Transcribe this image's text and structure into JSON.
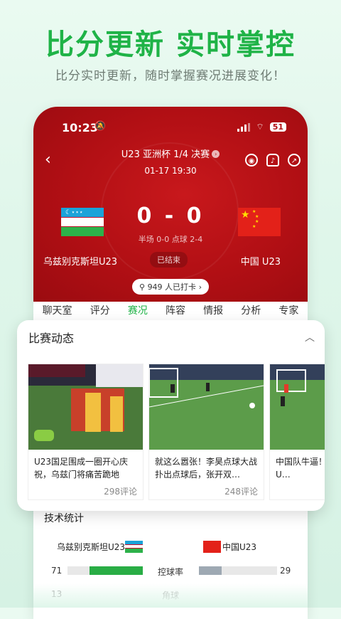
{
  "promo": {
    "headline": "比分更新 实时掌控",
    "subline": "比分实时更新，随时掌握赛况进展变化！"
  },
  "status_bar": {
    "time": "10:23",
    "battery": "51"
  },
  "match": {
    "title": "U23 亚洲杯 1/4 决赛",
    "datetime": "01-17 19:30",
    "score": "0 - 0",
    "detail": "半场 0-0 点球 2-4",
    "home_team": "乌兹别克斯坦U23",
    "away_team": "中国 U23",
    "state": "已结束",
    "checkin": "949 人已打卡"
  },
  "tabs": [
    "聊天室",
    "评分",
    "赛况",
    "阵容",
    "情报",
    "分析",
    "专家"
  ],
  "active_tab": "赛况",
  "highlights": {
    "title": "比赛动态",
    "cards": [
      {
        "text": "U23国足围成一圈开心庆祝，乌兹门将痛苦跪地",
        "comments": "298评论"
      },
      {
        "text": "就这么嚣张！李昊点球大战扑出点球后，张开双…",
        "comments": "248评论"
      },
      {
        "text": "中国队牛逼！制胜点球，U…",
        "comments": ""
      }
    ]
  },
  "stats": {
    "title": "技术统计",
    "home": "乌兹别克斯坦U23",
    "away": "中国U23",
    "rows": [
      {
        "label": "控球率",
        "home": "71",
        "away": "29",
        "home_pct": 71,
        "away_pct": 29
      },
      {
        "label": "角球",
        "home": "13",
        "away": ""
      }
    ]
  },
  "colors": {
    "brand": "#1fb347",
    "hero_red": "#b10f14"
  }
}
